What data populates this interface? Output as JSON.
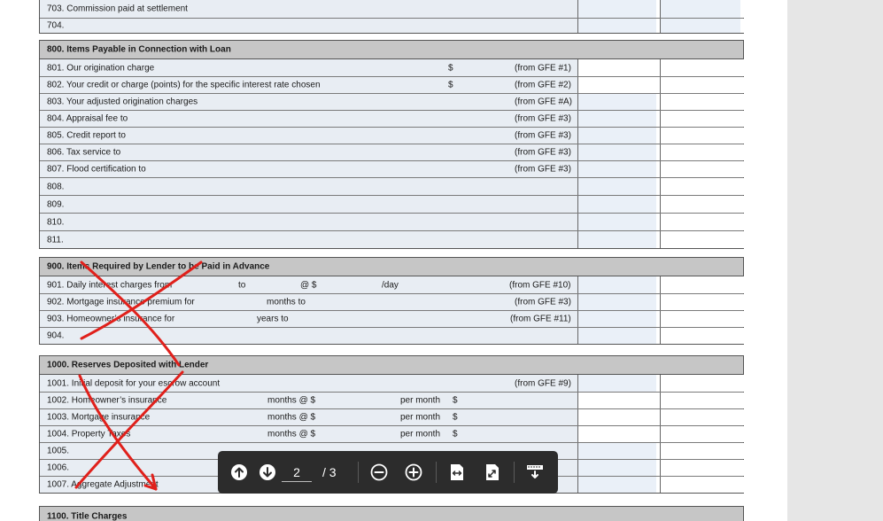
{
  "section_700_tail": [
    {
      "label": "703. Commission paid at settlement"
    },
    {
      "label": "704."
    }
  ],
  "section_800": {
    "title": "800. Items Payable in Connection with Loan",
    "rows": [
      {
        "label": "801. Our origination charge",
        "currency": "$",
        "ref": "(from GFE #1)"
      },
      {
        "label": "802. Your credit or charge (points) for the specific interest rate chosen",
        "currency": "$",
        "ref": "(from GFE #2)"
      },
      {
        "label": "803. Your adjusted origination charges",
        "currency": "",
        "ref": "(from GFE #A)"
      },
      {
        "label": "804. Appraisal fee to",
        "currency": "",
        "ref": "(from GFE #3)"
      },
      {
        "label": "805. Credit report to",
        "currency": "",
        "ref": "(from GFE #3)"
      },
      {
        "label": "806. Tax service to",
        "currency": "",
        "ref": "(from GFE #3)"
      },
      {
        "label": "807. Flood certification to",
        "currency": "",
        "ref": "(from GFE #3)"
      },
      {
        "label": "808.",
        "currency": "",
        "ref": ""
      },
      {
        "label": "809.",
        "currency": "",
        "ref": ""
      },
      {
        "label": "810.",
        "currency": "",
        "ref": ""
      },
      {
        "label": "811.",
        "currency": "",
        "ref": ""
      }
    ]
  },
  "section_900": {
    "title": "900. Items Required by Lender to be Paid in Advance",
    "row901": {
      "label": "901. Daily interest charges from",
      "to": "to",
      "at": "@ $",
      "per": "/day",
      "ref": "(from GFE #10)"
    },
    "row902": {
      "label": "902. Mortgage insurance premium for",
      "mid": "months to",
      "ref": "(from GFE #3)"
    },
    "row903": {
      "label": "903. Homeowner’s insurance for",
      "mid": "years to",
      "ref": "(from GFE #11)"
    },
    "row904": {
      "label": "904."
    }
  },
  "section_1000": {
    "title": "1000. Reserves Deposited with Lender",
    "row1001": {
      "label": "1001. Initial deposit for your escrow account",
      "ref": "(from GFE #9)"
    },
    "reserve_rows": [
      {
        "label": "1002. Homeowner’s insurance",
        "months": "months @ $",
        "per": "per month",
        "cur": "$"
      },
      {
        "label": "1003. Mortgage insurance",
        "months": "months @ $",
        "per": "per month",
        "cur": "$"
      },
      {
        "label": "1004. Property Taxes",
        "months": "months @ $",
        "per": "per month",
        "cur": "$"
      }
    ],
    "tail_rows": [
      {
        "label": "1005."
      },
      {
        "label": "1006."
      },
      {
        "label": "1007. Aggregate Adjustment"
      }
    ]
  },
  "section_1100": {
    "title": "1100. Title Charges"
  },
  "viewer_toolbar": {
    "current_page": "2",
    "total_pages": "/ 3",
    "icons": [
      "arrow-up-circle-icon",
      "arrow-down-circle-icon",
      "zoom-out-icon",
      "zoom-in-icon",
      "fit-width-icon",
      "fit-page-icon",
      "download-icon"
    ]
  },
  "colors": {
    "annotation_red": "#e0201b",
    "toolbar_bg": "#2c2c2c",
    "section_header_bg": "#c6c6c6",
    "form_field_bg": "#e8edf3"
  }
}
